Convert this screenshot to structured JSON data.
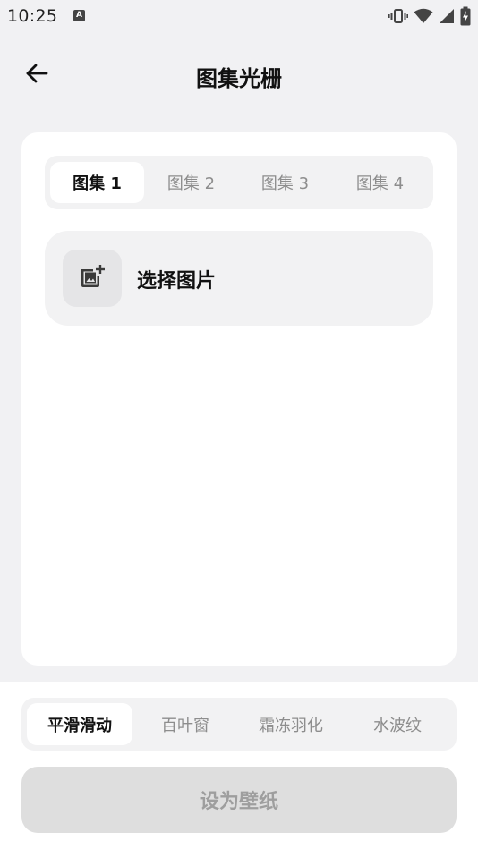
{
  "status_bar": {
    "time": "10:25",
    "notification_glyph": "A",
    "icons": [
      "vibrate-icon",
      "wifi-icon",
      "signal-icon",
      "battery-charging-icon"
    ]
  },
  "header": {
    "title": "图集光栅",
    "back_icon": "arrow-left-icon"
  },
  "gallery_tabs": {
    "items": [
      {
        "label": "图集 1",
        "active": true
      },
      {
        "label": "图集 2",
        "active": false
      },
      {
        "label": "图集 3",
        "active": false
      },
      {
        "label": "图集 4",
        "active": false
      }
    ]
  },
  "select_image": {
    "label": "选择图片",
    "icon": "add-photo-icon"
  },
  "effect_tabs": {
    "items": [
      {
        "label": "平滑滑动",
        "active": true
      },
      {
        "label": "百叶窗",
        "active": false
      },
      {
        "label": "霜冻羽化",
        "active": false
      },
      {
        "label": "水波纹",
        "active": false
      }
    ]
  },
  "actions": {
    "set_wallpaper_label": "设为壁纸"
  },
  "colors": {
    "background": "#f1f1f3",
    "card": "#ffffff",
    "segment_bg": "#f2f2f3",
    "inactive_text": "#8d8d8d",
    "disabled_button": "#dedede",
    "disabled_button_text": "#9e9e9e"
  }
}
